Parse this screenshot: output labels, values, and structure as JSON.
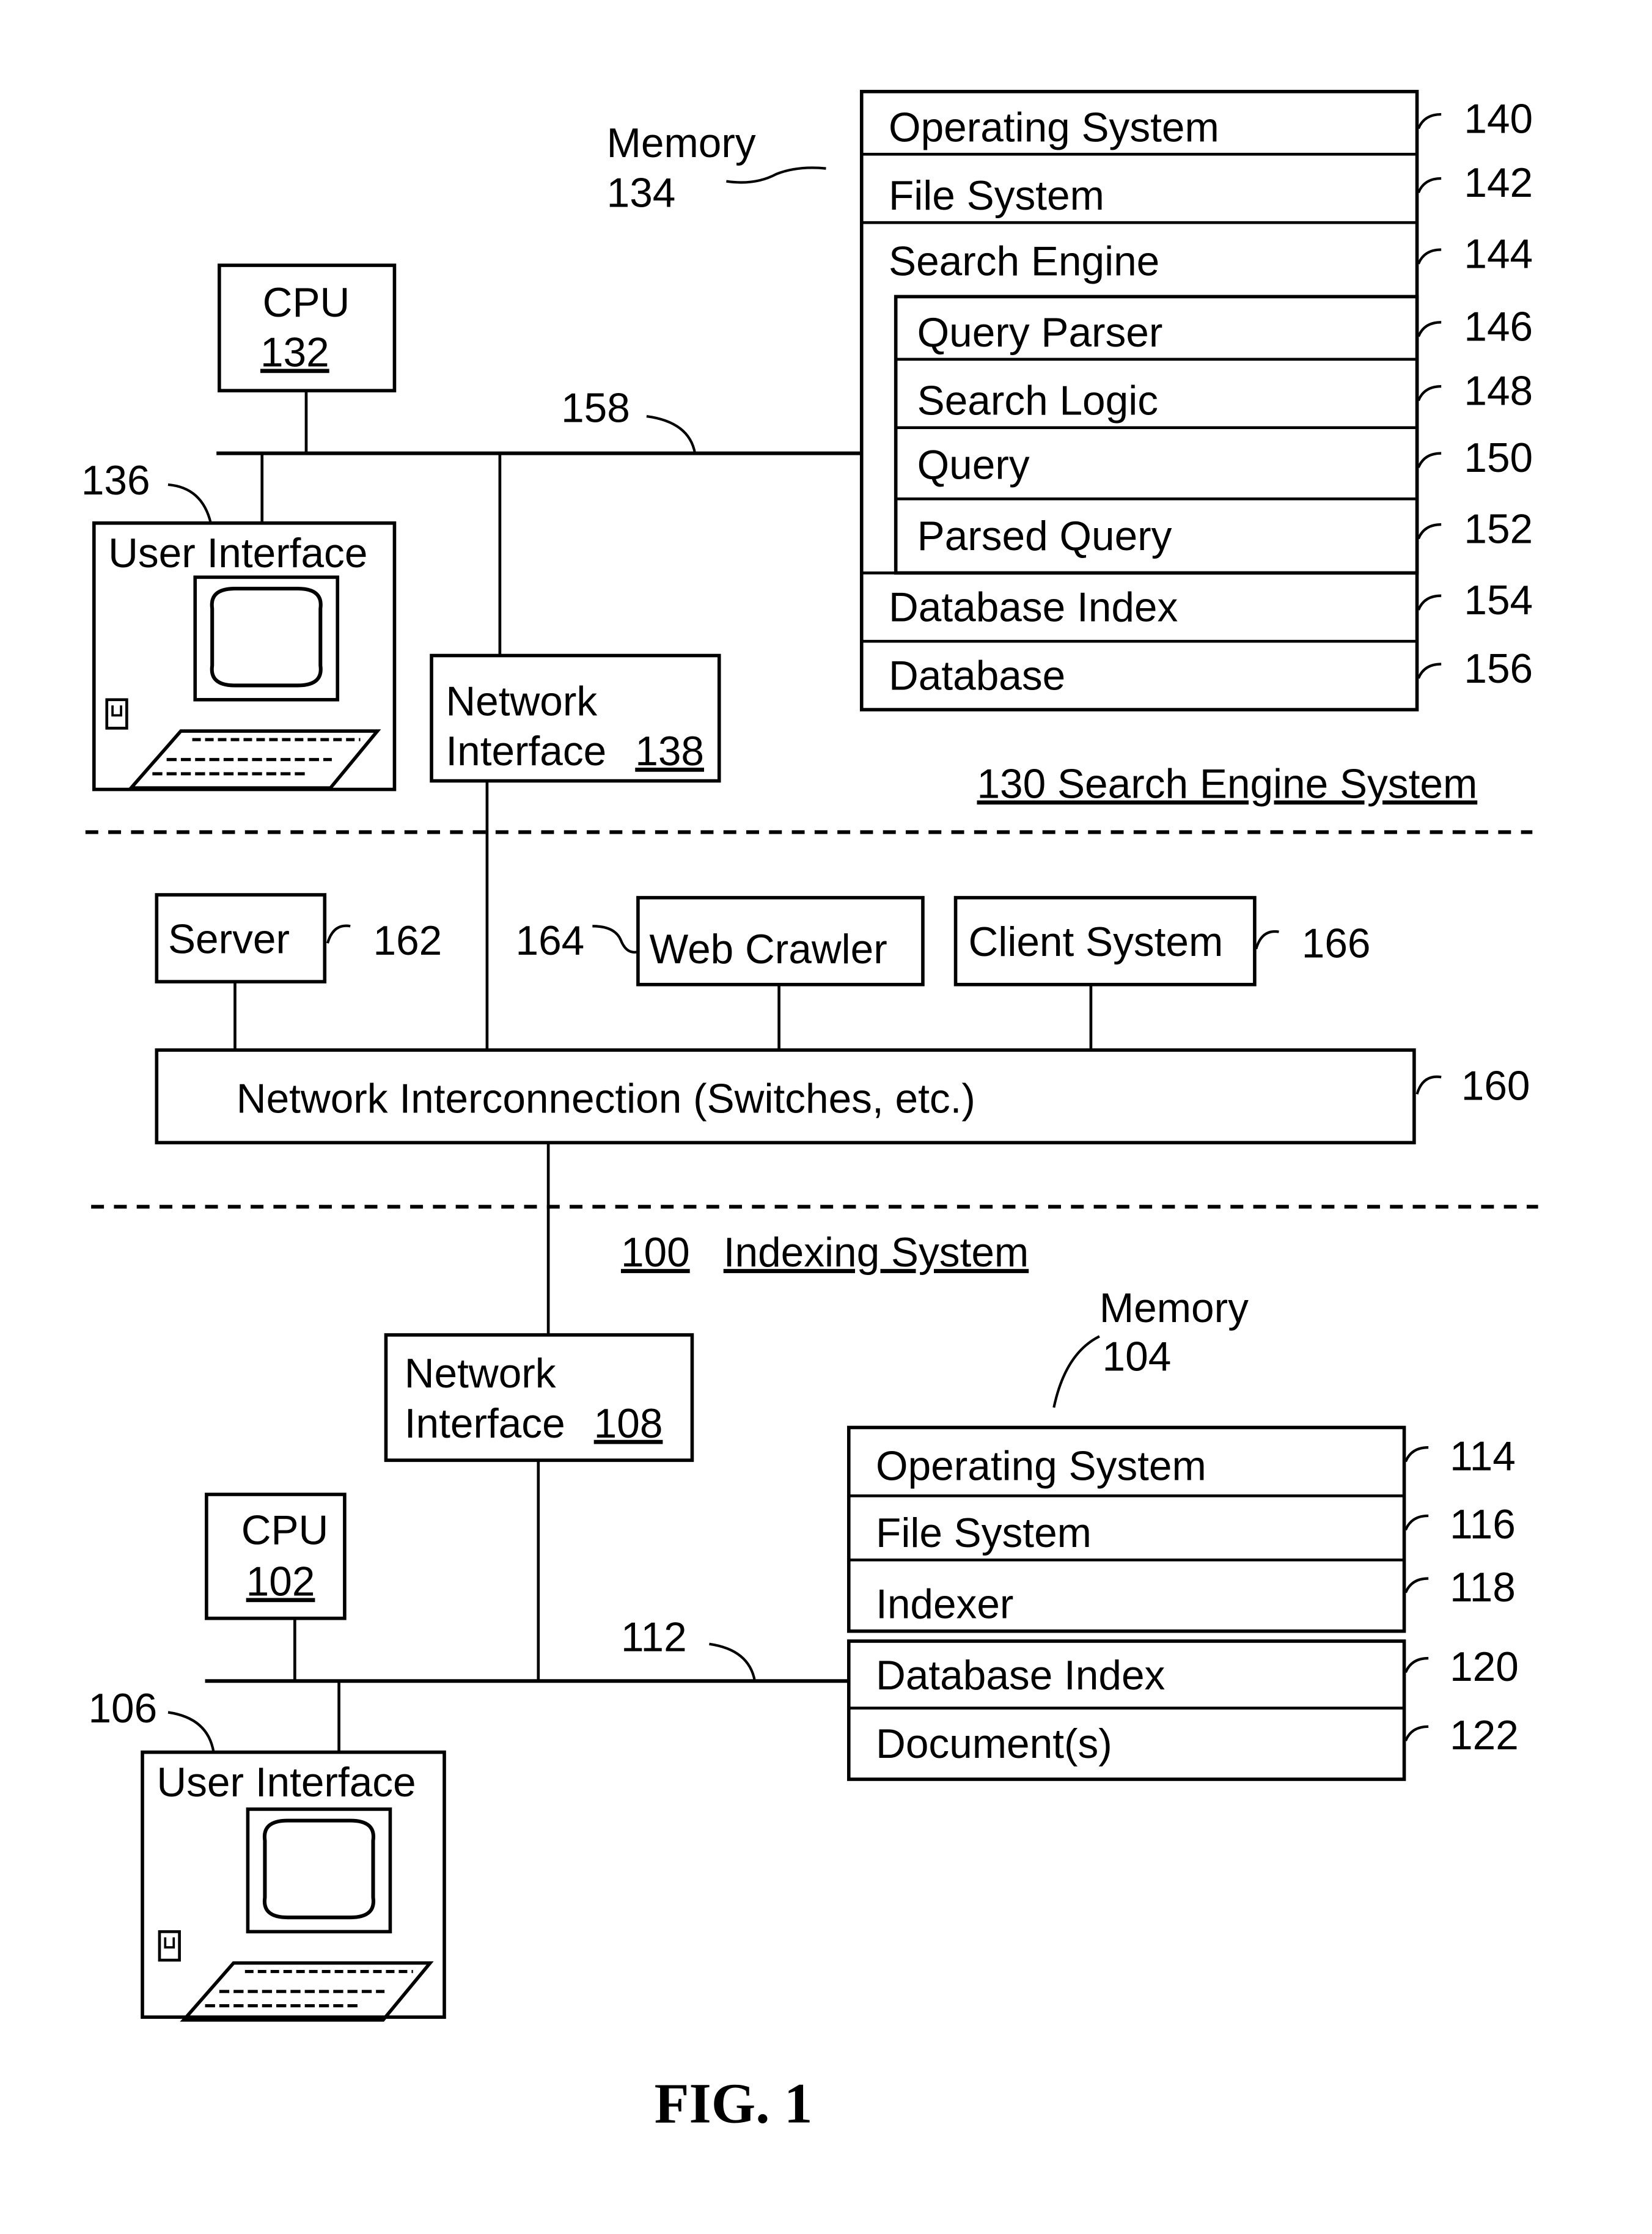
{
  "figure": {
    "caption": "FIG. 1"
  },
  "search_engine_system": {
    "label": "130 Search Engine System",
    "cpu": {
      "name": "CPU",
      "ref": "132"
    },
    "memory": {
      "name": "Memory",
      "ref": "134"
    },
    "user_interface": {
      "label": "User Interface",
      "ref": "136"
    },
    "network_interface": {
      "line1": "Network",
      "line2": "Interface",
      "ref": "138"
    },
    "bus_ref": "158",
    "memory_modules": [
      {
        "label": "Operating System",
        "ref": "140"
      },
      {
        "label": "File System",
        "ref": "142"
      },
      {
        "label": "Search Engine",
        "ref": "144"
      },
      {
        "label": "Query Parser",
        "ref": "146"
      },
      {
        "label": "Search Logic",
        "ref": "148"
      },
      {
        "label": "Query",
        "ref": "150"
      },
      {
        "label": "Parsed Query",
        "ref": "152"
      },
      {
        "label": "Database Index",
        "ref": "154"
      },
      {
        "label": "Database",
        "ref": "156"
      }
    ]
  },
  "network": {
    "interconnection": {
      "label": "Network Interconnection (Switches, etc.)",
      "ref": "160"
    },
    "server": {
      "label": "Server",
      "ref": "162"
    },
    "web_crawler": {
      "label": "Web Crawler",
      "ref": "164"
    },
    "client_system": {
      "label": "Client System",
      "ref": "166"
    }
  },
  "indexing_system": {
    "ref": "100",
    "label": "Indexing System",
    "cpu": {
      "name": "CPU",
      "ref": "102"
    },
    "memory": {
      "name": "Memory",
      "ref": "104"
    },
    "user_interface": {
      "label": "User Interface",
      "ref": "106"
    },
    "network_interface": {
      "line1": "Network",
      "line2": "Interface",
      "ref": "108"
    },
    "bus_ref": "112",
    "memory_modules": [
      {
        "label": "Operating System",
        "ref": "114"
      },
      {
        "label": "File System",
        "ref": "116"
      },
      {
        "label": "Indexer",
        "ref": "118"
      },
      {
        "label": "Database Index",
        "ref": "120"
      },
      {
        "label": "Document(s)",
        "ref": "122"
      }
    ]
  }
}
